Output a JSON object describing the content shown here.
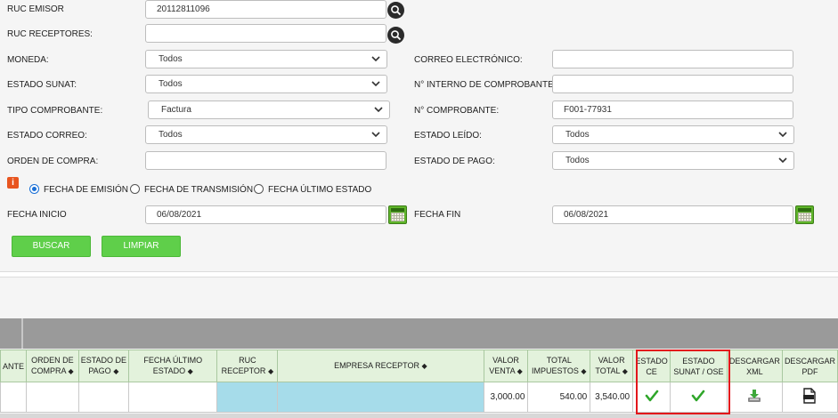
{
  "form": {
    "ruc_emisor": {
      "label": "RUC EMISOR",
      "value": "20112811096"
    },
    "ruc_receptores": {
      "label": "RUC RECEPTORES:",
      "value": ""
    },
    "moneda": {
      "label": "MONEDA:",
      "value": "Todos"
    },
    "estado_sunat": {
      "label": "ESTADO SUNAT:",
      "value": "Todos"
    },
    "tipo_comprobante": {
      "label": "TIPO COMPROBANTE:",
      "value": "Factura"
    },
    "estado_correo": {
      "label": "ESTADO CORREO:",
      "value": "Todos"
    },
    "orden_compra": {
      "label": "ORDEN DE COMPRA:",
      "value": ""
    },
    "correo_electronico": {
      "label": "CORREO ELECTRÓNICO:",
      "value": ""
    },
    "numero_interno": {
      "label": "N° INTERNO DE COMPROBANTE:",
      "value": ""
    },
    "numero_comprobante": {
      "label": "N° COMPROBANTE:",
      "value": "F001-77931"
    },
    "estado_leido": {
      "label": "ESTADO LEÍDO:",
      "value": "Todos"
    },
    "estado_pago": {
      "label": "ESTADO DE PAGO:",
      "value": "Todos"
    },
    "info_icon_glyph": "i",
    "date_type": {
      "options": [
        "FECHA DE EMISIÓN",
        "FECHA DE TRANSMISIÓN",
        "FECHA ÚLTIMO ESTADO"
      ],
      "selected": "FECHA DE EMISIÓN"
    },
    "fecha_inicio": {
      "label": "FECHA INICIO",
      "value": "06/08/2021"
    },
    "fecha_fin": {
      "label": "FECHA FIN",
      "value": "06/08/2021"
    },
    "buscar_label": "BUSCAR",
    "limpiar_label": "LIMPIAR"
  },
  "table": {
    "columns": [
      {
        "l1": "ANTE",
        "l2": ""
      },
      {
        "l1": "ORDEN DE",
        "l2": "COMPRA"
      },
      {
        "l1": "ESTADO DE",
        "l2": "PAGO"
      },
      {
        "l1": "FECHA ÚLTIMO",
        "l2": "ESTADO"
      },
      {
        "l1": "RUC",
        "l2": "RECEPTOR"
      },
      {
        "l1": "EMPRESA RECEPTOR",
        "l2": ""
      },
      {
        "l1": "VALOR",
        "l2": "VENTA"
      },
      {
        "l1": "TOTAL",
        "l2": "IMPUESTOS"
      },
      {
        "l1": "VALOR",
        "l2": "TOTAL"
      },
      {
        "l1": "ESTADO",
        "l2": "CE"
      },
      {
        "l1": "ESTADO",
        "l2": "SUNAT / OSE"
      },
      {
        "l1": "DESCARGAR",
        "l2": "XML"
      },
      {
        "l1": "DESCARGAR",
        "l2": "PDF"
      }
    ],
    "sort_glyph": "◆",
    "row": {
      "valor_venta": "3,000.00",
      "total_impuestos": "540.00",
      "valor_total": "3,540.00",
      "estado_ce": "check-icon",
      "estado_sunat": "check-icon",
      "xml": "download-xml-icon",
      "pdf": "pdf-icon"
    }
  },
  "colors": {
    "button_green": "#5fcf4a",
    "header_green": "#e3f2dc",
    "highlight_red": "#e3161b",
    "check_green": "#2fa62a",
    "receptor_blue": "#a6dcea"
  }
}
